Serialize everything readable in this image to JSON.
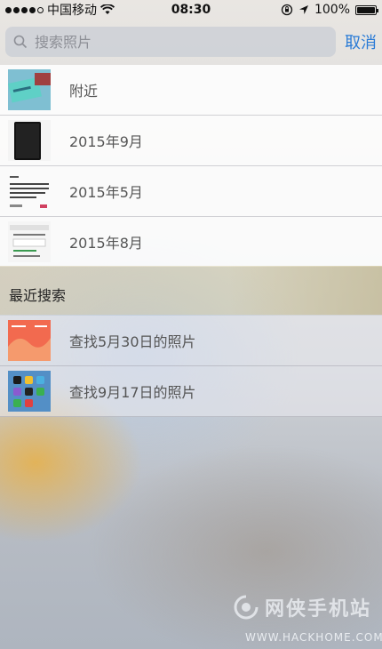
{
  "status_bar": {
    "carrier": "中国移动",
    "time": "08:30",
    "battery": "100%",
    "battery_level": 1.0,
    "signal_dots_filled": 4,
    "signal_dots_total": 5
  },
  "search": {
    "placeholder": "搜索照片",
    "cancel_label": "取消"
  },
  "suggestions": [
    {
      "label": "附近",
      "thumb": "card-photo"
    },
    {
      "label": "2015年9月",
      "thumb": "device-photo"
    },
    {
      "label": "2015年5月",
      "thumb": "document-photo"
    },
    {
      "label": "2015年8月",
      "thumb": "screenshot-photo"
    }
  ],
  "recent": {
    "title": "最近搜索",
    "items": [
      {
        "label": "查找5月30日的照片",
        "thumb": "red-screenshot"
      },
      {
        "label": "查找9月17日的照片",
        "thumb": "homescreen-screenshot"
      }
    ]
  },
  "watermark": {
    "text": "网侠手机站",
    "url": "WWW.HACKHOME.COM"
  },
  "colors": {
    "accent": "#2a7bd6"
  }
}
